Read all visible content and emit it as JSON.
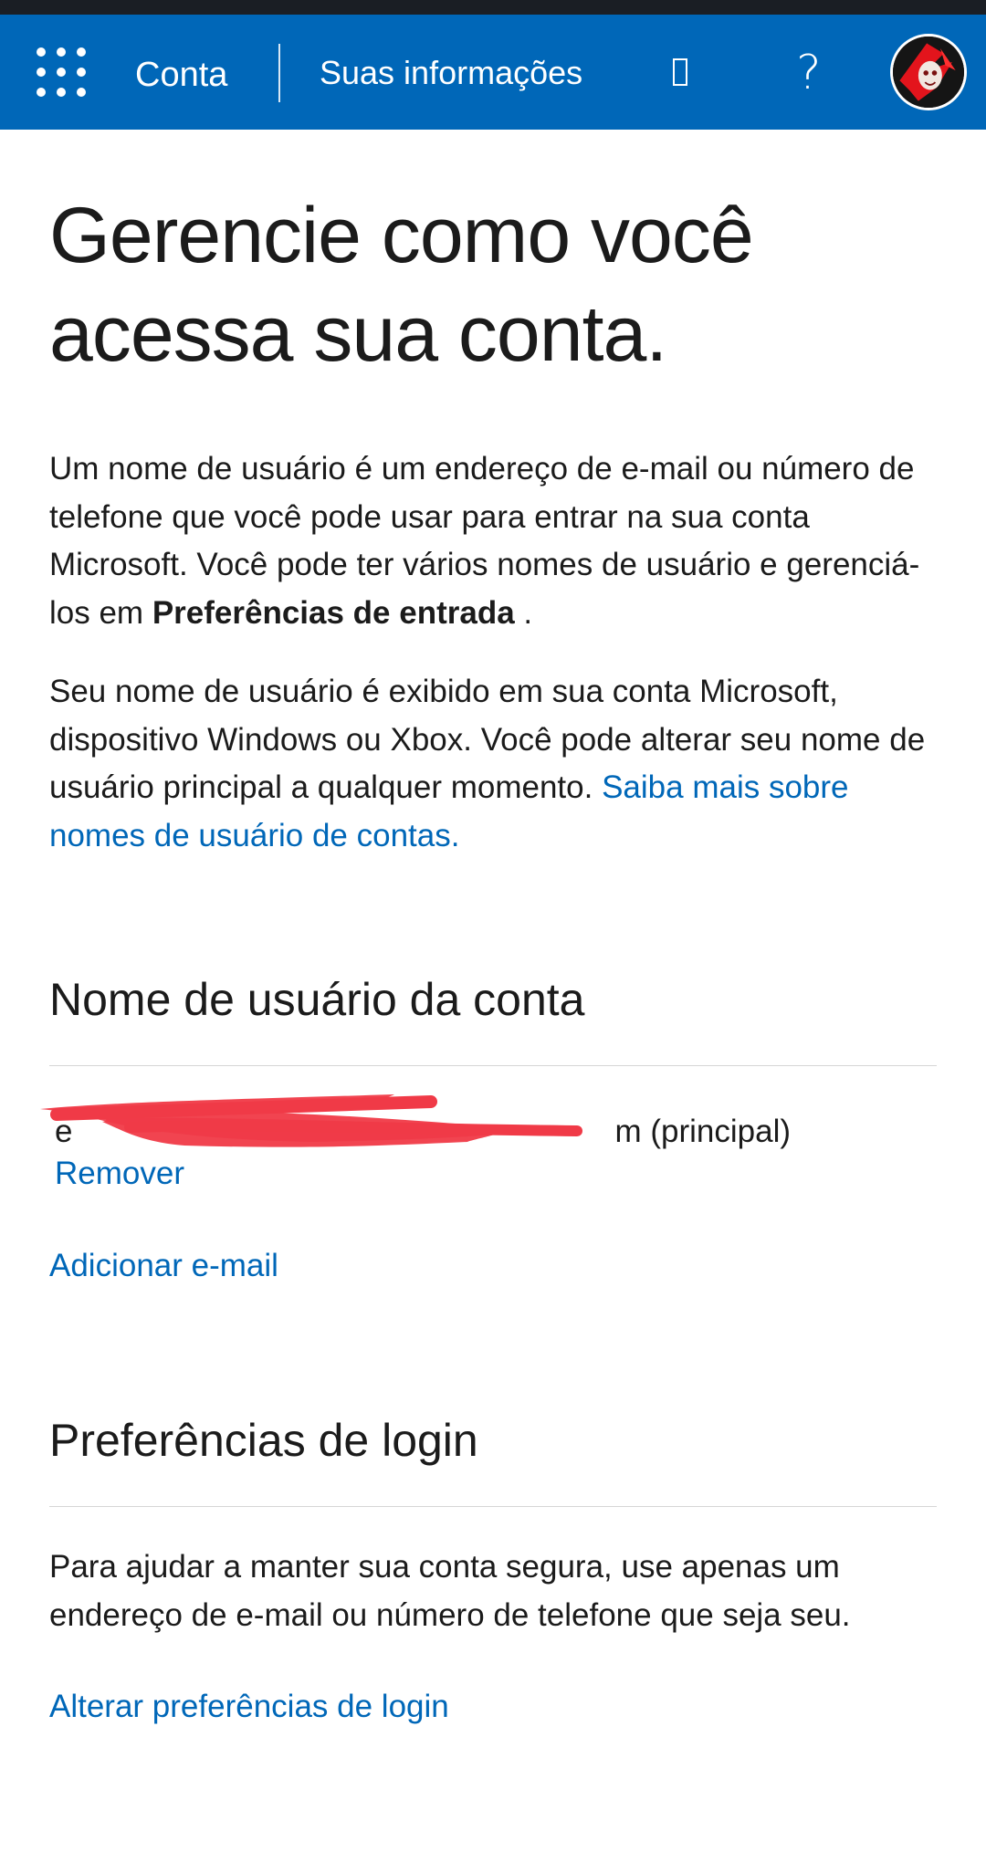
{
  "header": {
    "app_title": "Conta",
    "section_title": "Suas informações",
    "chevron_glyph": "",
    "help_glyph": "?",
    "waffle_icon": "app-launcher-icon",
    "background_color": "#0067b8"
  },
  "main": {
    "title": "Gerencie como você acessa sua conta.",
    "intro_paragraph": {
      "text": "Um nome de usuário é um endereço de e-mail ou número de telefone que você pode usar para entrar na sua conta Microsoft. Você pode ter vários nomes de usuário e gerenciá-los em ",
      "bold": "Preferências de entrada",
      "after": " ."
    },
    "second_paragraph": {
      "text": "Seu nome de usuário é exibido em sua conta Microsoft, dispositivo Windows ou Xbox. Você pode alterar seu nome de usuário principal a qualquer momento. ",
      "link": "Saiba mais sobre nomes de usuário de contas."
    },
    "account_usernames": {
      "heading": "Nome de usuário da conta",
      "email_visible_start": "e",
      "email_visible_end": "m (principal)",
      "remove_label": "Remover",
      "add_email_label": "Adicionar e-mail"
    },
    "login_preferences": {
      "heading": "Preferências de login",
      "description": "Para ajudar a manter sua conta segura, use apenas um endereço de e-mail ou número de telefone que seja seu.",
      "change_label": "Alterar preferências de login"
    }
  },
  "colors": {
    "link": "#0067b8",
    "text": "#1b1b1b",
    "redaction": "#f03a47"
  }
}
